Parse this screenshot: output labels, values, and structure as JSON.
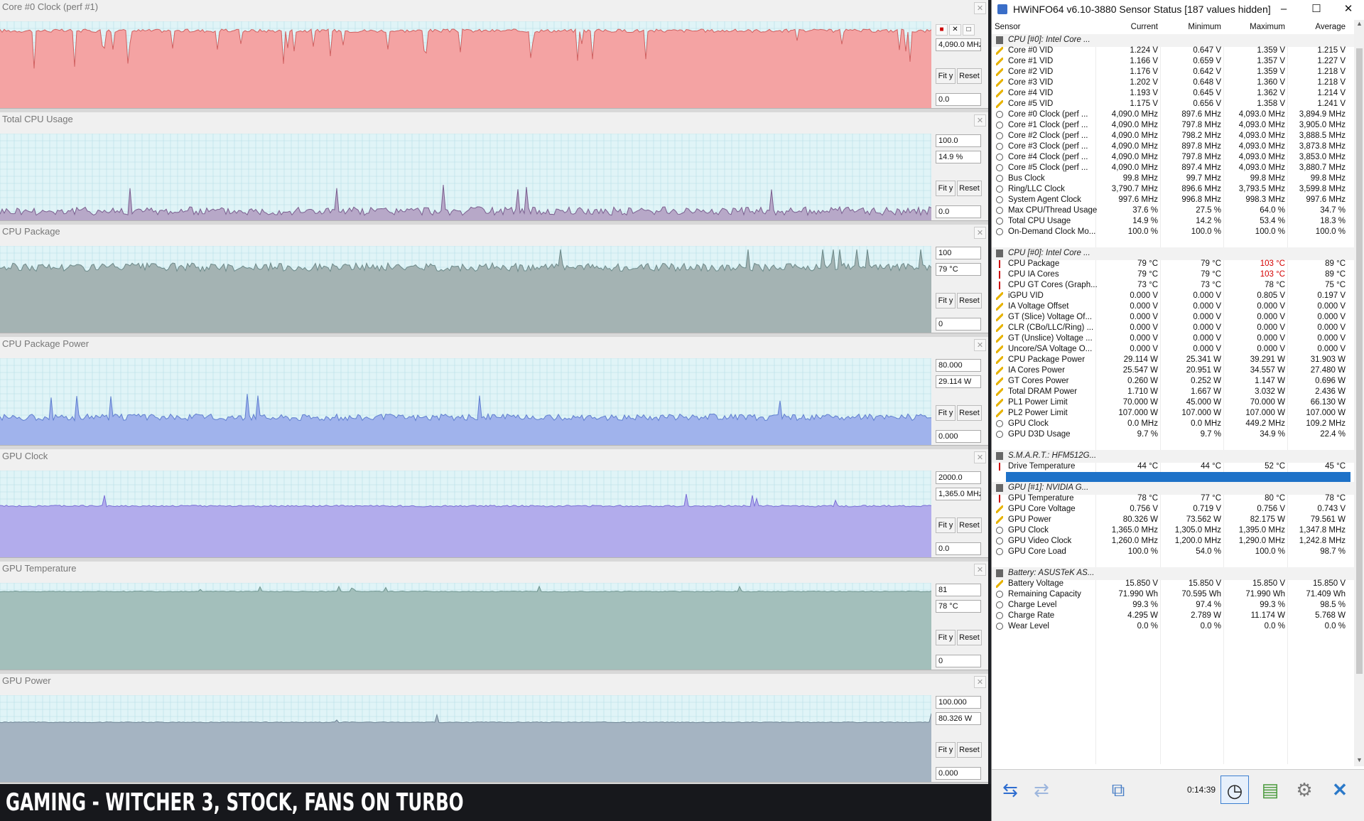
{
  "graphs": [
    {
      "title": "Core #0 Clock (perf #1)",
      "top": "",
      "current": "4,090.0 MHz",
      "bottom": "0.0",
      "fill": "#f4a3a3",
      "line": "#d06060",
      "level": 0.93,
      "spike": 0.02,
      "dips": true
    },
    {
      "title": "Total CPU Usage",
      "top": "100.0",
      "current": "14.9 %",
      "bottom": "0.0",
      "fill": "#b7a8c8",
      "line": "#7b5f8f",
      "level": 0.12,
      "spike": 0.05,
      "dips": false
    },
    {
      "title": "CPU Package",
      "top": "100",
      "current": "79 °C",
      "bottom": "0",
      "fill": "#a4b3b3",
      "line": "#6d8a8a",
      "level": 0.79,
      "spike": 0.05,
      "dips": false
    },
    {
      "title": "CPU Package Power",
      "top": "80.000",
      "current": "29.114 W",
      "bottom": "0.000",
      "fill": "#a0b3ec",
      "line": "#5f7fcf",
      "level": 0.34,
      "spike": 0.04,
      "dips": false
    },
    {
      "title": "GPU Clock",
      "top": "2000.0",
      "current": "1,365.0 MHz",
      "bottom": "0.0",
      "fill": "#b2acec",
      "line": "#7a70d6",
      "level": 0.62,
      "spike": 0.01,
      "dips": false
    },
    {
      "title": "GPU Temperature",
      "top": "81",
      "current": "78 °C",
      "bottom": "0",
      "fill": "#a3bfbb",
      "line": "#6f9590",
      "level": 0.94,
      "spike": 0.005,
      "dips": false
    },
    {
      "title": "GPU Power",
      "top": "100.000",
      "current": "80.326 W",
      "bottom": "0.000",
      "fill": "#a5b4c2",
      "line": "#6f8595",
      "level": 0.72,
      "spike": 0.005,
      "dips": false
    }
  ],
  "graph_buttons": {
    "fit": "Fit y",
    "reset": "Reset"
  },
  "caption": "GAMING - WITCHER 3, STOCK, FANS ON TURBO",
  "hwinfo": {
    "title": "HWiNFO64 v6.10-3880 Sensor Status [187 values hidden]",
    "window_buttons": {
      "minimize": "–",
      "maximize": "☐",
      "close": "✕"
    },
    "headers": {
      "sensor": "Sensor",
      "current": "Current",
      "minimum": "Minimum",
      "maximum": "Maximum",
      "average": "Average"
    },
    "rows": [
      {
        "t": "group",
        "n": "CPU [#0]: Intel Core ..."
      },
      {
        "t": "volt",
        "n": "Core #0 VID",
        "c": "1.224 V",
        "mi": "0.647 V",
        "ma": "1.359 V",
        "av": "1.215 V"
      },
      {
        "t": "volt",
        "n": "Core #1 VID",
        "c": "1.166 V",
        "mi": "0.659 V",
        "ma": "1.357 V",
        "av": "1.227 V"
      },
      {
        "t": "volt",
        "n": "Core #2 VID",
        "c": "1.176 V",
        "mi": "0.642 V",
        "ma": "1.359 V",
        "av": "1.218 V"
      },
      {
        "t": "volt",
        "n": "Core #3 VID",
        "c": "1.202 V",
        "mi": "0.648 V",
        "ma": "1.360 V",
        "av": "1.218 V"
      },
      {
        "t": "volt",
        "n": "Core #4 VID",
        "c": "1.193 V",
        "mi": "0.645 V",
        "ma": "1.362 V",
        "av": "1.214 V"
      },
      {
        "t": "volt",
        "n": "Core #5 VID",
        "c": "1.175 V",
        "mi": "0.656 V",
        "ma": "1.358 V",
        "av": "1.241 V"
      },
      {
        "t": "clock",
        "n": "Core #0 Clock (perf ...",
        "c": "4,090.0 MHz",
        "mi": "897.6 MHz",
        "ma": "4,093.0 MHz",
        "av": "3,894.9 MHz"
      },
      {
        "t": "clock",
        "n": "Core #1 Clock (perf ...",
        "c": "4,090.0 MHz",
        "mi": "797.8 MHz",
        "ma": "4,093.0 MHz",
        "av": "3,905.0 MHz"
      },
      {
        "t": "clock",
        "n": "Core #2 Clock (perf ...",
        "c": "4,090.0 MHz",
        "mi": "798.2 MHz",
        "ma": "4,093.0 MHz",
        "av": "3,888.5 MHz"
      },
      {
        "t": "clock",
        "n": "Core #3 Clock (perf ...",
        "c": "4,090.0 MHz",
        "mi": "897.8 MHz",
        "ma": "4,093.0 MHz",
        "av": "3,873.8 MHz"
      },
      {
        "t": "clock",
        "n": "Core #4 Clock (perf ...",
        "c": "4,090.0 MHz",
        "mi": "797.8 MHz",
        "ma": "4,093.0 MHz",
        "av": "3,853.0 MHz"
      },
      {
        "t": "clock",
        "n": "Core #5 Clock (perf ...",
        "c": "4,090.0 MHz",
        "mi": "897.4 MHz",
        "ma": "4,093.0 MHz",
        "av": "3,880.7 MHz"
      },
      {
        "t": "clock",
        "n": "Bus Clock",
        "c": "99.8 MHz",
        "mi": "99.7 MHz",
        "ma": "99.8 MHz",
        "av": "99.8 MHz"
      },
      {
        "t": "clock",
        "n": "Ring/LLC Clock",
        "c": "3,790.7 MHz",
        "mi": "896.6 MHz",
        "ma": "3,793.5 MHz",
        "av": "3,599.8 MHz"
      },
      {
        "t": "clock",
        "n": "System Agent Clock",
        "c": "997.6 MHz",
        "mi": "996.8 MHz",
        "ma": "998.3 MHz",
        "av": "997.6 MHz"
      },
      {
        "t": "clock",
        "n": "Max CPU/Thread Usage",
        "c": "37.6 %",
        "mi": "27.5 %",
        "ma": "64.0 %",
        "av": "34.7 %"
      },
      {
        "t": "clock",
        "n": "Total CPU Usage",
        "c": "14.9 %",
        "mi": "14.2 %",
        "ma": "53.4 %",
        "av": "18.3 %"
      },
      {
        "t": "clock",
        "n": "On-Demand Clock Mo...",
        "c": "100.0 %",
        "mi": "100.0 %",
        "ma": "100.0 %",
        "av": "100.0 %"
      },
      {
        "t": "blank"
      },
      {
        "t": "group",
        "n": "CPU [#0]: Intel Core ..."
      },
      {
        "t": "temp",
        "n": "CPU Package",
        "c": "79 °C",
        "mi": "79 °C",
        "ma": "103 °C",
        "av": "89 °C",
        "red": true
      },
      {
        "t": "temp",
        "n": "CPU IA Cores",
        "c": "79 °C",
        "mi": "79 °C",
        "ma": "103 °C",
        "av": "89 °C",
        "red": true
      },
      {
        "t": "temp",
        "n": "CPU GT Cores (Graph...",
        "c": "73 °C",
        "mi": "73 °C",
        "ma": "78 °C",
        "av": "75 °C"
      },
      {
        "t": "volt",
        "n": "iGPU VID",
        "c": "0.000 V",
        "mi": "0.000 V",
        "ma": "0.805 V",
        "av": "0.197 V"
      },
      {
        "t": "volt",
        "n": "IA Voltage Offset",
        "c": "0.000 V",
        "mi": "0.000 V",
        "ma": "0.000 V",
        "av": "0.000 V"
      },
      {
        "t": "volt",
        "n": "GT (Slice) Voltage Of...",
        "c": "0.000 V",
        "mi": "0.000 V",
        "ma": "0.000 V",
        "av": "0.000 V"
      },
      {
        "t": "volt",
        "n": "CLR (CBo/LLC/Ring) ...",
        "c": "0.000 V",
        "mi": "0.000 V",
        "ma": "0.000 V",
        "av": "0.000 V"
      },
      {
        "t": "volt",
        "n": "GT (Unslice) Voltage ...",
        "c": "0.000 V",
        "mi": "0.000 V",
        "ma": "0.000 V",
        "av": "0.000 V"
      },
      {
        "t": "volt",
        "n": "Uncore/SA Voltage O...",
        "c": "0.000 V",
        "mi": "0.000 V",
        "ma": "0.000 V",
        "av": "0.000 V"
      },
      {
        "t": "volt",
        "n": "CPU Package Power",
        "c": "29.114 W",
        "mi": "25.341 W",
        "ma": "39.291 W",
        "av": "31.903 W"
      },
      {
        "t": "volt",
        "n": "IA Cores Power",
        "c": "25.547 W",
        "mi": "20.951 W",
        "ma": "34.557 W",
        "av": "27.480 W"
      },
      {
        "t": "volt",
        "n": "GT Cores Power",
        "c": "0.260 W",
        "mi": "0.252 W",
        "ma": "1.147 W",
        "av": "0.696 W"
      },
      {
        "t": "volt",
        "n": "Total DRAM Power",
        "c": "1.710 W",
        "mi": "1.667 W",
        "ma": "3.032 W",
        "av": "2.436 W"
      },
      {
        "t": "volt",
        "n": "PL1 Power Limit",
        "c": "70.000 W",
        "mi": "45.000 W",
        "ma": "70.000 W",
        "av": "66.130 W"
      },
      {
        "t": "volt",
        "n": "PL2 Power Limit",
        "c": "107.000 W",
        "mi": "107.000 W",
        "ma": "107.000 W",
        "av": "107.000 W"
      },
      {
        "t": "clock",
        "n": "GPU Clock",
        "c": "0.0 MHz",
        "mi": "0.0 MHz",
        "ma": "449.2 MHz",
        "av": "109.2 MHz"
      },
      {
        "t": "clock",
        "n": "GPU D3D Usage",
        "c": "9.7 %",
        "mi": "9.7 %",
        "ma": "34.9 %",
        "av": "22.4 %"
      },
      {
        "t": "blank"
      },
      {
        "t": "group",
        "n": "S.M.A.R.T.: HFM512G..."
      },
      {
        "t": "temp",
        "n": "Drive Temperature",
        "c": "44 °C",
        "mi": "44 °C",
        "ma": "52 °C",
        "av": "45 °C"
      },
      {
        "t": "selected"
      },
      {
        "t": "group",
        "n": "GPU [#1]: NVIDIA G..."
      },
      {
        "t": "temp",
        "n": "GPU Temperature",
        "c": "78 °C",
        "mi": "77 °C",
        "ma": "80 °C",
        "av": "78 °C"
      },
      {
        "t": "volt",
        "n": "GPU Core Voltage",
        "c": "0.756 V",
        "mi": "0.719 V",
        "ma": "0.756 V",
        "av": "0.743 V"
      },
      {
        "t": "volt",
        "n": "GPU Power",
        "c": "80.326 W",
        "mi": "73.562 W",
        "ma": "82.175 W",
        "av": "79.561 W"
      },
      {
        "t": "clock",
        "n": "GPU Clock",
        "c": "1,365.0 MHz",
        "mi": "1,305.0 MHz",
        "ma": "1,395.0 MHz",
        "av": "1,347.8 MHz"
      },
      {
        "t": "clock",
        "n": "GPU Video Clock",
        "c": "1,260.0 MHz",
        "mi": "1,200.0 MHz",
        "ma": "1,290.0 MHz",
        "av": "1,242.8 MHz"
      },
      {
        "t": "clock",
        "n": "GPU Core Load",
        "c": "100.0 %",
        "mi": "54.0 %",
        "ma": "100.0 %",
        "av": "98.7 %"
      },
      {
        "t": "blank"
      },
      {
        "t": "group",
        "n": "Battery: ASUSTeK AS..."
      },
      {
        "t": "volt",
        "n": "Battery Voltage",
        "c": "15.850 V",
        "mi": "15.850 V",
        "ma": "15.850 V",
        "av": "15.850 V"
      },
      {
        "t": "clock",
        "n": "Remaining Capacity",
        "c": "71.990 Wh",
        "mi": "70.595 Wh",
        "ma": "71.990 Wh",
        "av": "71.409 Wh"
      },
      {
        "t": "clock",
        "n": "Charge Level",
        "c": "99.3 %",
        "mi": "97.4 %",
        "ma": "99.3 %",
        "av": "98.5 %"
      },
      {
        "t": "clock",
        "n": "Charge Rate",
        "c": "4.295 W",
        "mi": "2.789 W",
        "ma": "11.174 W",
        "av": "5.768 W"
      },
      {
        "t": "clock",
        "n": "Wear Level",
        "c": "0.0 %",
        "mi": "0.0 %",
        "ma": "0.0 %",
        "av": "0.0 %"
      }
    ],
    "timer": "0:14:39",
    "toolbar_icons": [
      "arrow-left-right-icon",
      "arrow-right-left-icon",
      "network-icon",
      "clock-icon",
      "report-icon",
      "settings-icon",
      "close-icon"
    ]
  }
}
